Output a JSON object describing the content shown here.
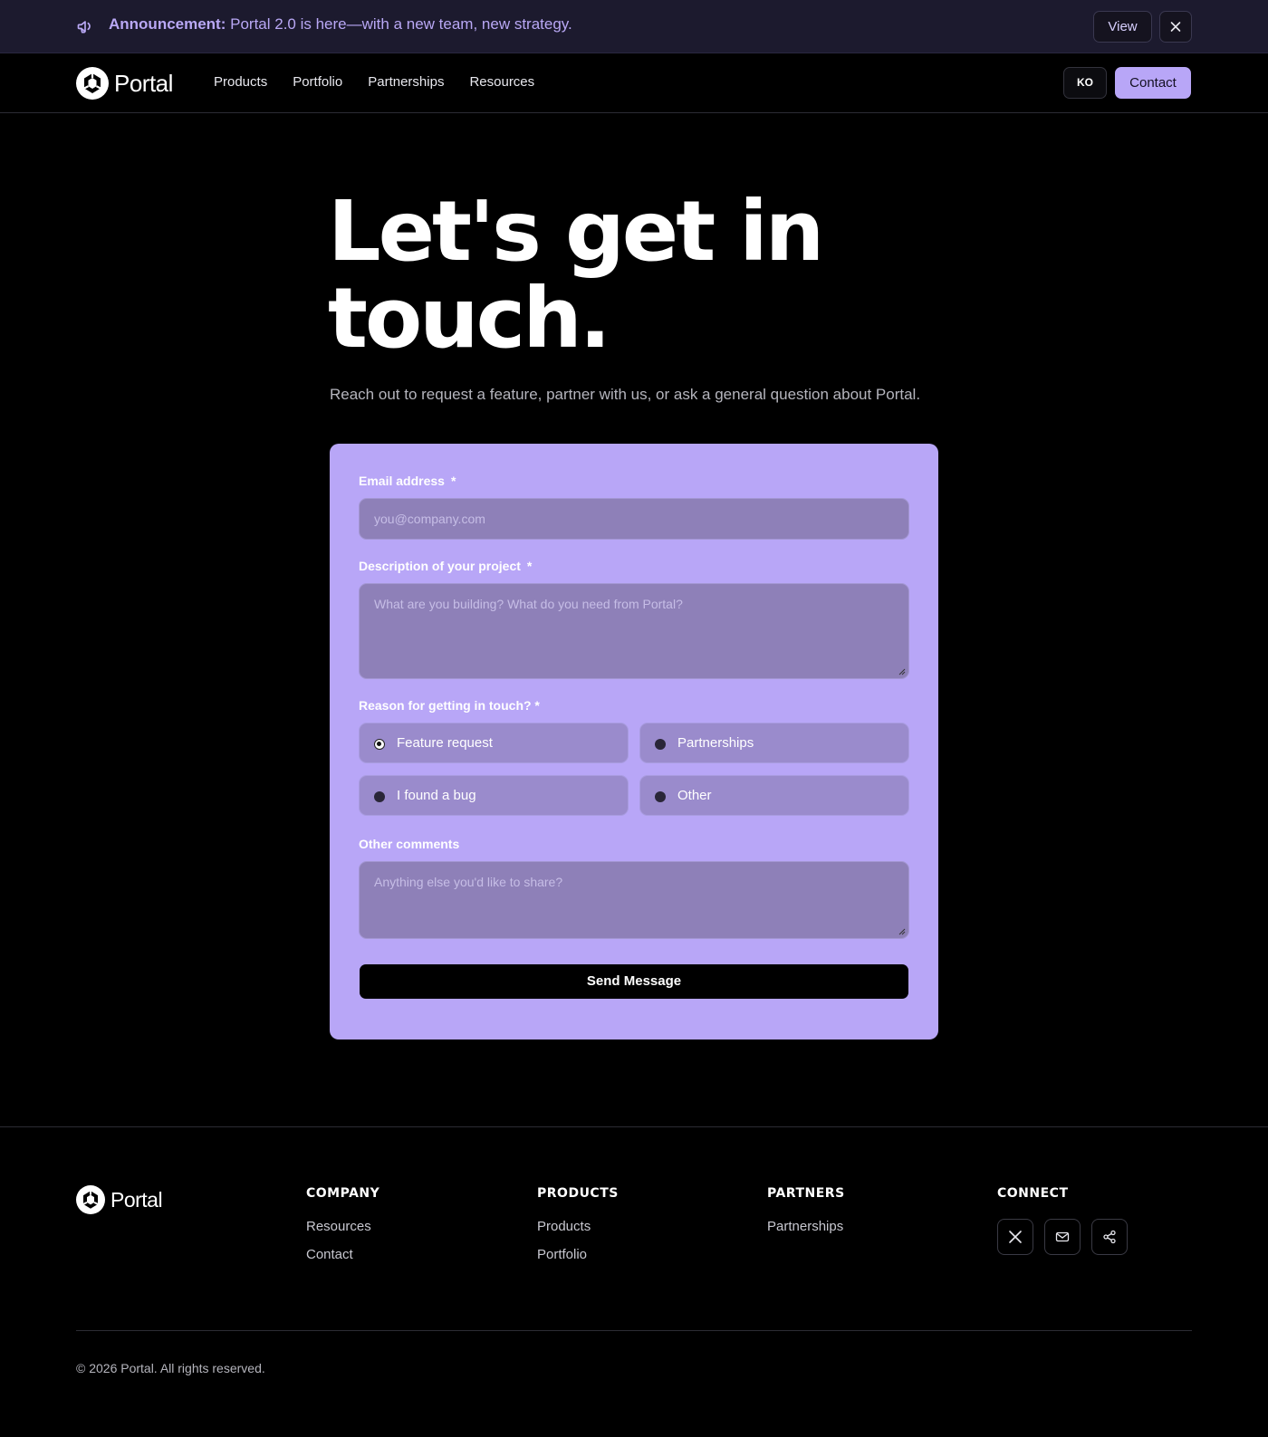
{
  "announcement": {
    "label": "Announcement:",
    "text": " Portal 2.0 is here—with a new team, new strategy.",
    "view_label": "View"
  },
  "nav": {
    "logo_text": "Portal",
    "links": [
      "Products",
      "Portfolio",
      "Partnerships",
      "Resources"
    ],
    "lang_label": "KO",
    "contact_label": "Contact"
  },
  "hero": {
    "title": "Let's get in touch.",
    "subtitle": "Reach out to request a feature, partner with us, or ask a general question about Portal."
  },
  "form": {
    "email_label": "Email address",
    "email_req": "*",
    "email_placeholder": "you@company.com",
    "description_label": "Description of your project",
    "description_req": "*",
    "description_placeholder": "What are you building? What do you need from Portal?",
    "reason_label": "Reason for getting in touch? *",
    "reasons": [
      "Feature request",
      "Partnerships",
      "I found a bug",
      "Other"
    ],
    "selected_reason": "Feature request",
    "comments_label": "Other comments",
    "comments_placeholder": "Anything else you'd like to share?",
    "submit_label": "Send Message"
  },
  "footer": {
    "logo_text": "Portal",
    "columns": [
      {
        "heading": "COMPANY",
        "links": [
          "Resources",
          "Contact"
        ]
      },
      {
        "heading": "PRODUCTS",
        "links": [
          "Products",
          "Portfolio"
        ]
      },
      {
        "heading": "PARTNERS",
        "links": [
          "Partnerships"
        ]
      },
      {
        "heading": "CONNECT",
        "icons": [
          "x-icon",
          "mail-icon",
          "share-icon"
        ]
      }
    ],
    "copyright": "© 2026 Portal. All rights reserved."
  },
  "colors": {
    "accent": "#b8a6f7",
    "background": "#000000",
    "announcement_bg": "#1c1a2e",
    "input_bg": "#8e80b8"
  }
}
